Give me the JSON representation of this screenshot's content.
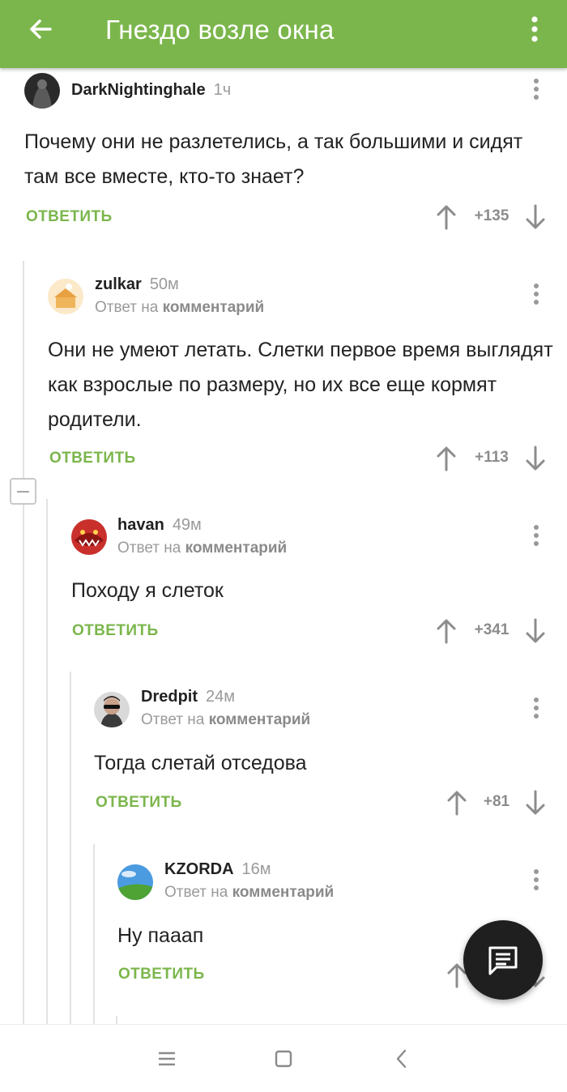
{
  "app_bar": {
    "title": "Гнездо возле окна",
    "back_icon": "arrow-left-icon",
    "menu_icon": "more-vert-icon",
    "color": "#7bb64c"
  },
  "comments": [
    {
      "author": "DarkNightinghale",
      "time": "1ч",
      "reply_to": null,
      "text": "Почему они не разлетелись, а так большими и сидят там все вместе, кто-то знает?",
      "reply_label": "ОТВЕТИТЬ",
      "score": "+135"
    },
    {
      "author": "zulkar",
      "time": "50м",
      "reply_to_prefix": "Ответ на",
      "reply_to_link": "комментарий",
      "text": "Они не умеют летать. Слетки первое время выглядят как взрослые по размеру, но их все еще кормят родители.",
      "reply_label": "ОТВЕТИТЬ",
      "score": "+113"
    },
    {
      "author": "havan",
      "time": "49м",
      "reply_to_prefix": "Ответ на",
      "reply_to_link": "комментарий",
      "text": "Походу я слеток",
      "reply_label": "ОТВЕТИТЬ",
      "score": "+341"
    },
    {
      "author": "Dredpit",
      "time": "24м",
      "reply_to_prefix": "Ответ на",
      "reply_to_link": "комментарий",
      "text": "Тогда слетай отседова",
      "reply_label": "ОТВЕТИТЬ",
      "score": "+81"
    },
    {
      "author": "KZORDA",
      "time": "16м",
      "reply_to_prefix": "Ответ на",
      "reply_to_link": "комментарий",
      "text": "Ну пааап",
      "reply_label": "ОТВЕТИТЬ",
      "score": ""
    }
  ],
  "fab": {
    "icon": "comment-icon"
  },
  "system_nav": {
    "icons": [
      "menu-icon",
      "home-icon",
      "back-icon"
    ]
  },
  "colors": {
    "accent": "#7bb64c",
    "text": "#222222",
    "muted": "#9a9a9a"
  }
}
